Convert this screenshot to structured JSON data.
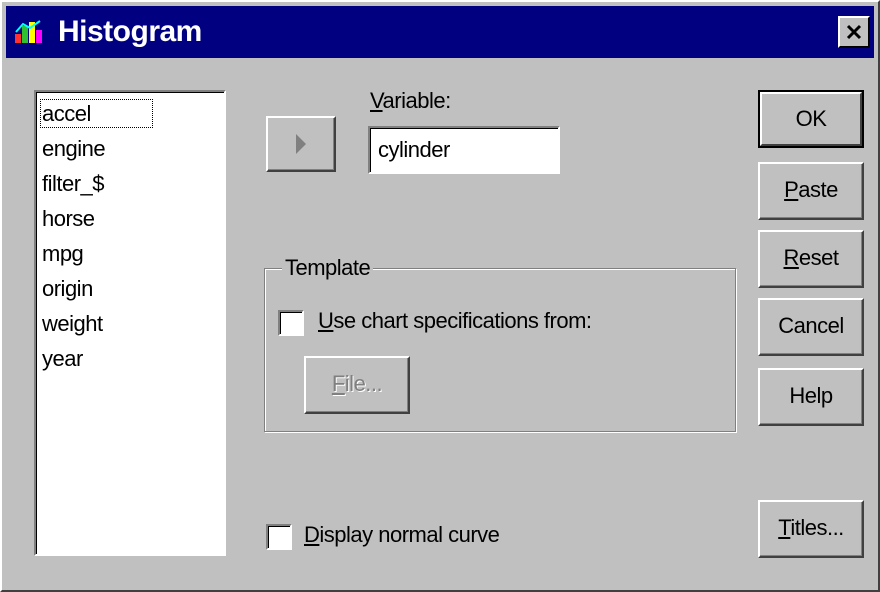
{
  "window": {
    "title": "Histogram",
    "close_icon": "close-x"
  },
  "variable_list": {
    "items": [
      "accel",
      "engine",
      "filter_$",
      "horse",
      "mpg",
      "origin",
      "weight",
      "year"
    ],
    "focused": "accel"
  },
  "move_button": {
    "icon": "right-arrow"
  },
  "variable": {
    "label_accel": "V",
    "label_rest": "ariable:",
    "value": "cylinder"
  },
  "buttons": {
    "ok": "OK",
    "paste_accel": "P",
    "paste_rest": "aste",
    "reset_accel": "R",
    "reset_rest": "eset",
    "cancel": "Cancel",
    "help": "Help",
    "titles_accel": "T",
    "titles_rest": "itles..."
  },
  "template": {
    "legend": "Template",
    "use_chart_accel": "U",
    "use_chart_rest": "se chart specifications from:",
    "use_chart_checked": false,
    "file_accel": "F",
    "file_rest": "ile...",
    "file_enabled": false
  },
  "normal_curve": {
    "accel": "D",
    "rest": "isplay normal curve",
    "checked": false
  },
  "colors": {
    "titlebar": "#000080",
    "face": "#c0c0c0",
    "disabled_text": "#808080"
  }
}
